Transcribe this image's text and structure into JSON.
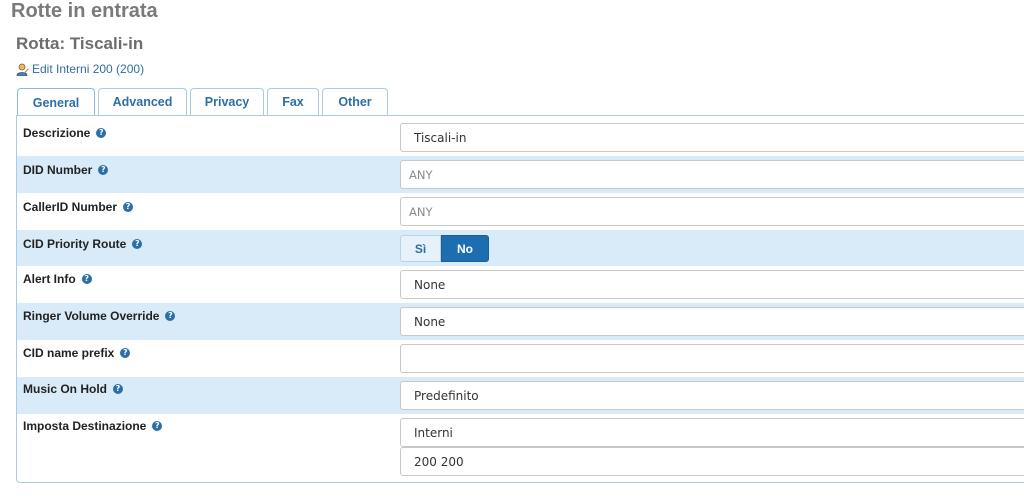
{
  "page": {
    "title": "Rotte in entrata",
    "route_title": "Rotta: Tiscali-in",
    "edit_link": "Edit Interni 200 (200)"
  },
  "tabs": [
    {
      "label": "General",
      "active": true
    },
    {
      "label": "Advanced",
      "active": false
    },
    {
      "label": "Privacy",
      "active": false
    },
    {
      "label": "Fax",
      "active": false
    },
    {
      "label": "Other",
      "active": false
    }
  ],
  "form": {
    "descrizione": {
      "label": "Descrizione",
      "value": "Tiscali-in"
    },
    "did_number": {
      "label": "DID Number",
      "value": "",
      "placeholder": "ANY"
    },
    "callerid_number": {
      "label": "CallerID Number",
      "value": "",
      "placeholder": "ANY"
    },
    "cid_priority_route": {
      "label": "CID Priority Route",
      "options": [
        "Sì",
        "No"
      ],
      "selected": "No"
    },
    "alert_info": {
      "label": "Alert Info",
      "value": "None"
    },
    "ringer_volume_override": {
      "label": "Ringer Volume Override",
      "value": "None"
    },
    "cid_name_prefix": {
      "label": "CID name prefix",
      "value": ""
    },
    "music_on_hold": {
      "label": "Music On Hold",
      "value": "Predefinito"
    },
    "imposta_destinazione": {
      "label": "Imposta Destinazione",
      "type_value": "Interni",
      "target_value": "200 200"
    }
  },
  "icons": {
    "help": "help-icon",
    "edit": "user-edit-icon"
  },
  "colors": {
    "accent": "#1d6eb0",
    "link": "#2f6ea5",
    "row_shade": "#d9ebf8",
    "border": "#a9cce0"
  }
}
